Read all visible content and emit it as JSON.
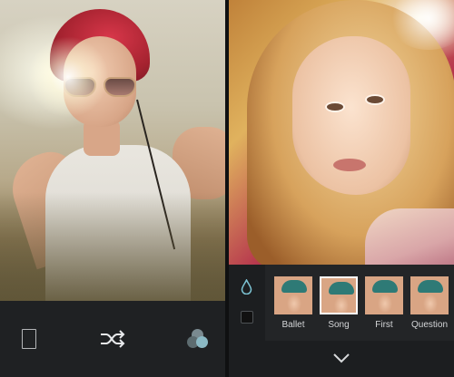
{
  "left_screen": {
    "photo": {
      "description_icon": "photo-preview"
    },
    "toolbar": {
      "frame_icon": "frame-icon",
      "shuffle_icon": "shuffle-icon",
      "filters_icon": "filters-icon"
    }
  },
  "right_screen": {
    "photo": {
      "description_icon": "photo-preview"
    },
    "side_tools": {
      "drop_icon": "drop-icon",
      "square_icon": "square-icon"
    },
    "filters": [
      {
        "label": "Ballet",
        "selected": false
      },
      {
        "label": "Song",
        "selected": true
      },
      {
        "label": "First",
        "selected": false
      },
      {
        "label": "Question",
        "selected": false
      }
    ],
    "collapse_icon": "chevron-down-icon"
  },
  "colors": {
    "background": "#1e2022",
    "accent": "#8bb9c4",
    "selected_border": "#ffffff"
  }
}
